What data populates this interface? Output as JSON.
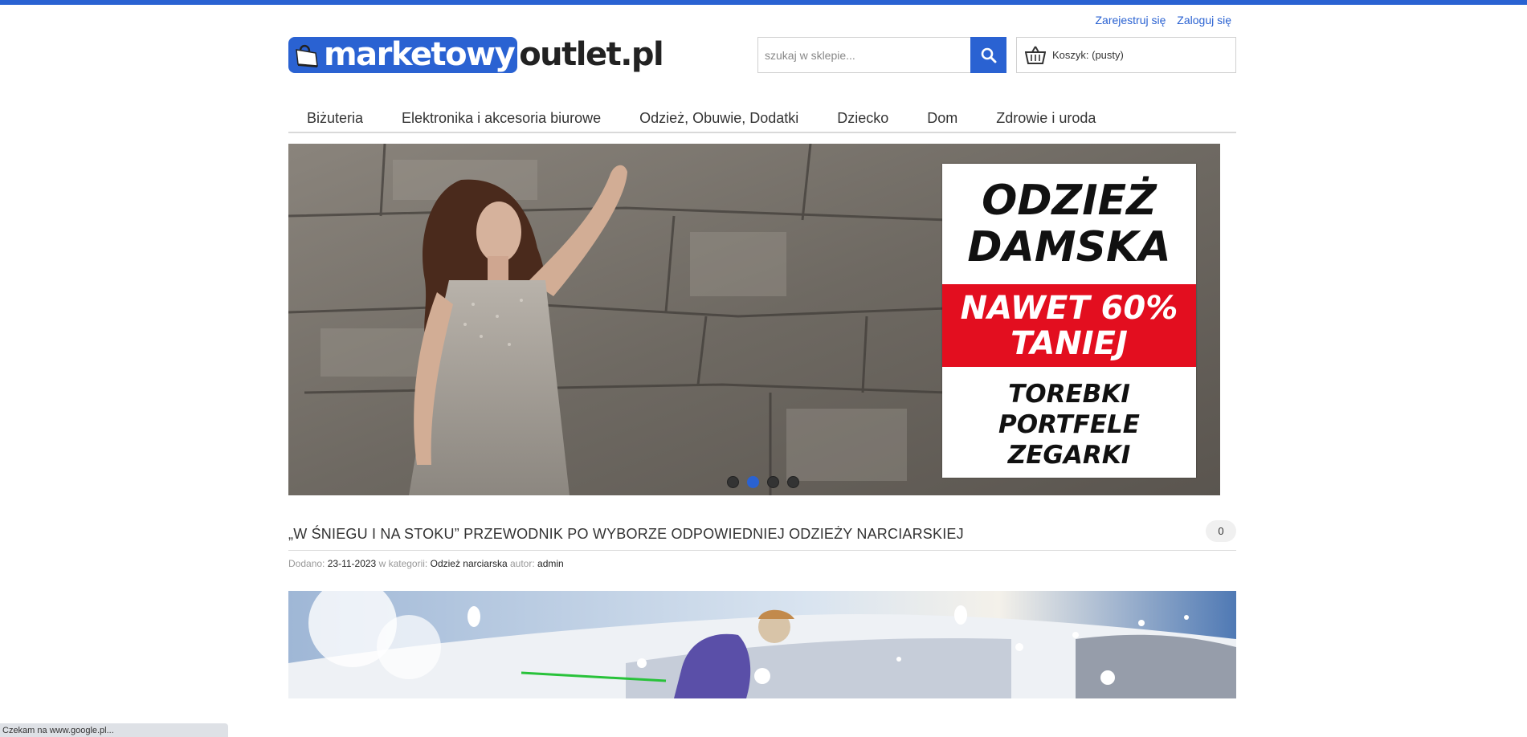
{
  "header": {
    "register_link": "Zarejestruj się",
    "login_link": "Zaloguj się",
    "logo_part1": "marketowy",
    "logo_part2": "outlet.pl",
    "search_placeholder": "szukaj w sklepie...",
    "cart_label": "Koszyk: (pusty)"
  },
  "nav": {
    "items": [
      "Biżuteria",
      "Elektronika i akcesoria biurowe",
      "Odzież, Obuwie, Dodatki",
      "Dziecko",
      "Dom",
      "Zdrowie i uroda"
    ]
  },
  "banner": {
    "headline_line1": "ODZIEŻ",
    "headline_line2": "DAMSKA",
    "promo_line1": "NAWET 60%",
    "promo_line2": "TANIEJ",
    "items_line1": "TOREBKI",
    "items_line2": "PORTFELE",
    "items_line3": "ZEGARKI",
    "slides_count": 4,
    "active_slide": 2
  },
  "post": {
    "title": "„W ŚNIEGU I NA STOKU” PRZEWODNIK PO WYBORZE ODPOWIEDNIEJ ODZIEŻY NARCIARSKIEJ",
    "comments": "0",
    "added_label": "Dodano:",
    "date": "23-11-2023",
    "category_label": "w kategorii:",
    "category": "Odzież narciarska",
    "author_label": "autor:",
    "author": "admin"
  },
  "status": {
    "text": "Czekam na www.google.pl..."
  },
  "colors": {
    "accent": "#2a62d2",
    "promo_red": "#e30e1f"
  },
  "icons": [
    "search-icon",
    "basket-icon",
    "shopping-bag-icon"
  ]
}
